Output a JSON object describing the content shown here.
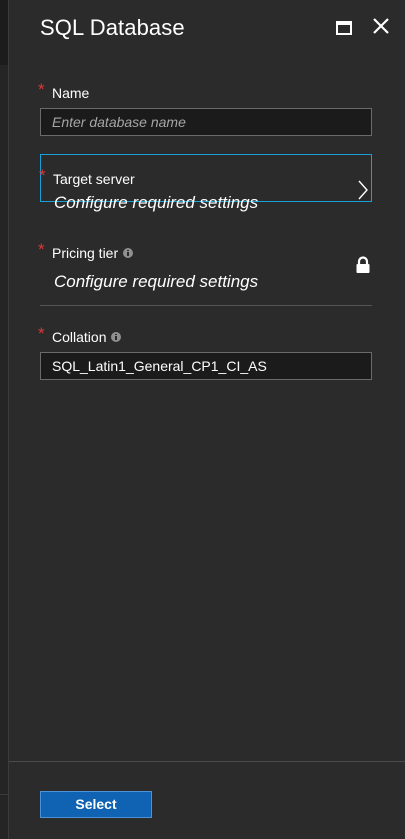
{
  "blade": {
    "title": "SQL Database"
  },
  "header_icons": {
    "maximize": "maximize-icon",
    "close": "close-icon"
  },
  "form": {
    "required_marker": "*",
    "name": {
      "label": "Name",
      "placeholder": "Enter database name",
      "value": ""
    },
    "target_server": {
      "label": "Target server",
      "value": "Configure required settings"
    },
    "pricing_tier": {
      "label": "Pricing tier",
      "value": "Configure required settings",
      "locked": true
    },
    "collation": {
      "label": "Collation",
      "value": "SQL_Latin1_General_CP1_CI_AS"
    }
  },
  "footer": {
    "select_label": "Select"
  },
  "colors": {
    "panel_background": "#2b2b2b",
    "required_asterisk": "#e0353b",
    "focus_border": "#1aa0d8",
    "primary_button": "#0f63b2"
  }
}
